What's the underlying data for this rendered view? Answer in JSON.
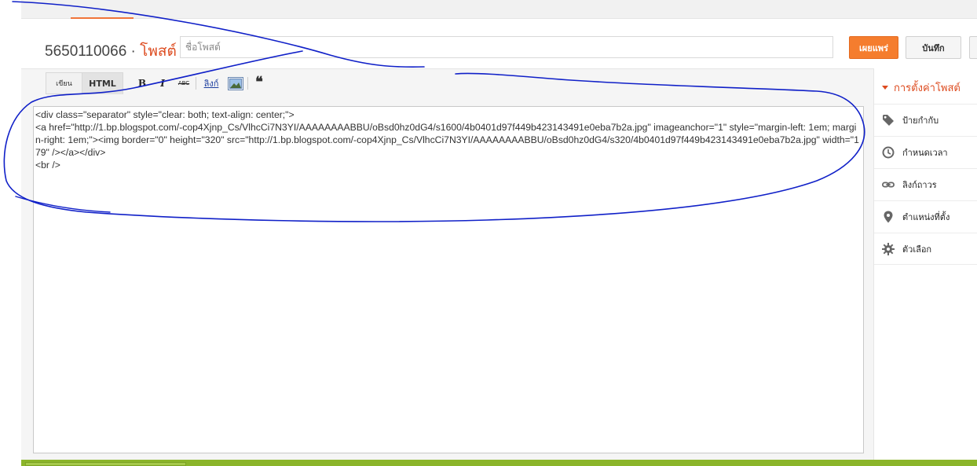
{
  "header": {
    "blog_id": "5650110066",
    "separator": "·",
    "post_word": "โพสต์",
    "title_placeholder": "ชื่อโพสต์",
    "publish_label": "เผยแพร่",
    "save_label": "บันทึก"
  },
  "toolbar": {
    "compose_tab": "เขียน",
    "html_tab": "HTML",
    "bold": "B",
    "italic": "I",
    "strike": "ABC",
    "link": "ลิงก์",
    "quote": "❝"
  },
  "editor": {
    "html_content": "<div class=\"separator\" style=\"clear: both; text-align: center;\">\n<a href=\"http://1.bp.blogspot.com/-cop4Xjnp_Cs/VlhcCi7N3YI/AAAAAAAABBU/oBsd0hz0dG4/s1600/4b0401d97f449b423143491e0eba7b2a.jpg\" imageanchor=\"1\" style=\"margin-left: 1em; margin-right: 1em;\"><img border=\"0\" height=\"320\" src=\"http://1.bp.blogspot.com/-cop4Xjnp_Cs/VlhcCi7N3YI/AAAAAAAABBU/oBsd0hz0dG4/s320/4b0401d97f449b423143491e0eba7b2a.jpg\" width=\"179\" /></a></div>\n<br />"
  },
  "sidebar": {
    "header": "การตั้งค่าโพสต์",
    "items": [
      {
        "label": "ป้ายกำกับ",
        "icon": "tag-icon"
      },
      {
        "label": "กำหนดเวลา",
        "icon": "clock-icon"
      },
      {
        "label": "ลิงก์ถาวร",
        "icon": "link-icon"
      },
      {
        "label": "ตำแหน่งที่ตั้ง",
        "icon": "location-pin-icon"
      },
      {
        "label": "ตัวเลือก",
        "icon": "gear-icon"
      }
    ]
  },
  "colors": {
    "accent_orange": "#f57d2e",
    "brand_text_orange": "#dd4b1f",
    "bottom_bar_green": "#8bb52a",
    "annotation_blue": "#1020c8"
  }
}
